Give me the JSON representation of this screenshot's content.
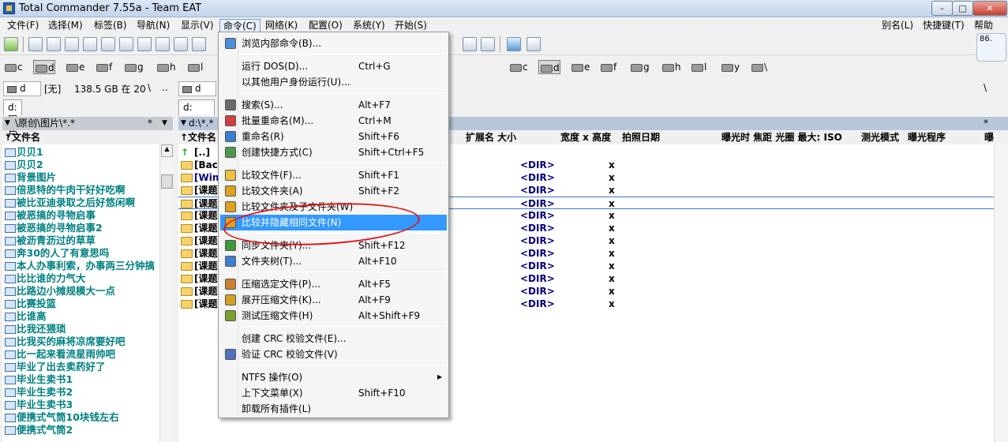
{
  "window": {
    "title": "Total Commander 7.55a - Team EAT",
    "min": "–",
    "max": "□",
    "close": "✕"
  },
  "menubar": {
    "items": [
      "文件(F)",
      "选择(M)",
      "标签(B)",
      "导航(N)",
      "显示(V)",
      "命令(C)",
      "网络(K)",
      "配置(O)",
      "系统(Y)",
      "开始(S)"
    ],
    "right_items": [
      "别名(L)",
      "快捷键(T)",
      "帮助"
    ]
  },
  "info_box": "86.",
  "left_drivebar": {
    "drives": [
      "c",
      "d",
      "e",
      "f",
      "g",
      "h",
      "l"
    ],
    "selected": "d"
  },
  "right_drivebar": {
    "drives": [
      "c",
      "d",
      "e",
      "f",
      "g",
      "h",
      "l",
      "y",
      "\\"
    ],
    "selected": "d"
  },
  "left_pathbar": {
    "drive": "d",
    "label": "[无]",
    "free": "138.5 GB 在 20",
    "root": "\\",
    "up": ".."
  },
  "right_pathbar": {
    "drive": "d",
    "root": "\\"
  },
  "left_tab": "d:图片",
  "right_tab": "d:",
  "left_curpath": "\\原创\\图片\\*.*",
  "right_curpath": "d:\\*.*",
  "star": "*",
  "columns": {
    "left_name": "↑文件名",
    "right_name": "↑文件名",
    "ext_size": "扩展名 大小",
    "dims": "宽度 x 高度",
    "date": "拍照日期",
    "exif": "曝光时 焦距 光圈 最大: ISO",
    "meter": "测光模式",
    "program": "曝光程序",
    "extra": "曝"
  },
  "left_files": [
    "贝贝1",
    "贝贝2",
    "背景图片",
    "倍思特的牛肉干好好吃啊",
    "被比亚迪录取之后好悠闲啊",
    "被恶搞的寻物启事",
    "被恶搞的寻物启事2",
    "被沥青沥过的草草",
    "奔30的人了有意思吗",
    "本人办事利索，办事两三分钟搞",
    "比比谁的力气大",
    "比路边小摊规模大一点",
    "比赛投篮",
    "比谁高",
    "比我还猥琐",
    "比我买的麻将凉席要好吧",
    "比一起来看流星雨帅吧",
    "毕业了出去卖药好了",
    "毕业生卖书1",
    "毕业生卖书2",
    "毕业生卖书3",
    "便携式气筒10块钱左右",
    "便携式气筒2"
  ],
  "right_files": [
    {
      "name": "[..]",
      "size": "",
      "x": ""
    },
    {
      "name": "[Back",
      "size": "<DIR>",
      "x": "x"
    },
    {
      "name": "[Wind",
      "size": "<DIR>",
      "x": "x"
    },
    {
      "name": "[课题",
      "size": "<DIR>",
      "x": "x"
    },
    {
      "name": "[课题",
      "size": "<DIR>",
      "x": "x"
    },
    {
      "name": "[课题",
      "size": "<DIR>",
      "x": "x"
    },
    {
      "name": "[课题",
      "size": "<DIR>",
      "x": "x"
    },
    {
      "name": "[课题",
      "size": "<DIR>",
      "x": "x"
    },
    {
      "name": "[课题",
      "size": "<DIR>",
      "x": "x"
    },
    {
      "name": "[课题",
      "size": "<DIR>",
      "x": "x"
    },
    {
      "name": "[课题",
      "size": "<DIR>",
      "x": "x"
    },
    {
      "name": "[课题",
      "size": "<DIR>",
      "x": "x"
    },
    {
      "name": "[课题",
      "size": "<DIR>",
      "x": "x"
    }
  ],
  "context_menu": [
    {
      "label": "浏览内部命令(B)...",
      "key": "",
      "icon": "browse-commands-icon",
      "highlight": false
    },
    {
      "sep": true
    },
    {
      "label": "运行 DOS(D)...",
      "key": "Ctrl+G",
      "icon": "",
      "highlight": false
    },
    {
      "label": "以其他用户身份运行(U)...",
      "key": "",
      "icon": "",
      "highlight": false
    },
    {
      "sep": true
    },
    {
      "label": "搜索(S)...",
      "key": "Alt+F7",
      "icon": "binoculars-icon",
      "highlight": false
    },
    {
      "label": "批量重命名(M)...",
      "key": "Ctrl+M",
      "icon": "multi-rename-icon",
      "highlight": false
    },
    {
      "label": "重命名(R)",
      "key": "Shift+F6",
      "icon": "rename-icon",
      "highlight": false
    },
    {
      "label": "创建快捷方式(C)",
      "key": "Shift+Ctrl+F5",
      "icon": "shortcut-icon",
      "highlight": false
    },
    {
      "sep": true
    },
    {
      "label": "比较文件(F)...",
      "key": "Shift+F1",
      "icon": "compare-files-icon",
      "highlight": false
    },
    {
      "label": "比较文件夹(A)",
      "key": "Shift+F2",
      "icon": "compare-folders-icon",
      "highlight": false
    },
    {
      "label": "比较文件夹及子文件夹(W)",
      "key": "",
      "icon": "compare-subfolders-icon",
      "highlight": false
    },
    {
      "label": "比较并隐藏相同文件(N)",
      "key": "",
      "icon": "compare-hide-icon",
      "highlight": true
    },
    {
      "sep": true
    },
    {
      "label": "同步文件夹(Y)...",
      "key": "Shift+F12",
      "icon": "sync-icon",
      "highlight": false
    },
    {
      "label": "文件夹树(T)...",
      "key": "Alt+F10",
      "icon": "folder-tree-icon",
      "highlight": false
    },
    {
      "sep": true
    },
    {
      "label": "压缩选定文件(P)...",
      "key": "Alt+F5",
      "icon": "pack-icon",
      "highlight": false
    },
    {
      "label": "展开压缩文件(K)...",
      "key": "Alt+F9",
      "icon": "unpack-icon",
      "highlight": false
    },
    {
      "label": "测试压缩文件(H)",
      "key": "Alt+Shift+F9",
      "icon": "test-archive-icon",
      "highlight": false
    },
    {
      "sep": true
    },
    {
      "label": "创建 CRC 校验文件(E)...",
      "key": "",
      "icon": "",
      "highlight": false
    },
    {
      "label": "验证 CRC 校验文件(V)",
      "key": "",
      "icon": "verify-crc-icon",
      "highlight": false
    },
    {
      "sep": true
    },
    {
      "label": "NTFS 操作(O)",
      "key": "",
      "icon": "",
      "submenu": "▶",
      "highlight": false
    },
    {
      "label": "上下文菜单(X)",
      "key": "Shift+F10",
      "icon": "",
      "highlight": false
    },
    {
      "label": "卸载所有插件(L)",
      "key": "",
      "icon": "",
      "highlight": false
    }
  ],
  "colors": {
    "highlight": "#3399ff",
    "file_text": "#008080",
    "annotation": "#e01818"
  }
}
